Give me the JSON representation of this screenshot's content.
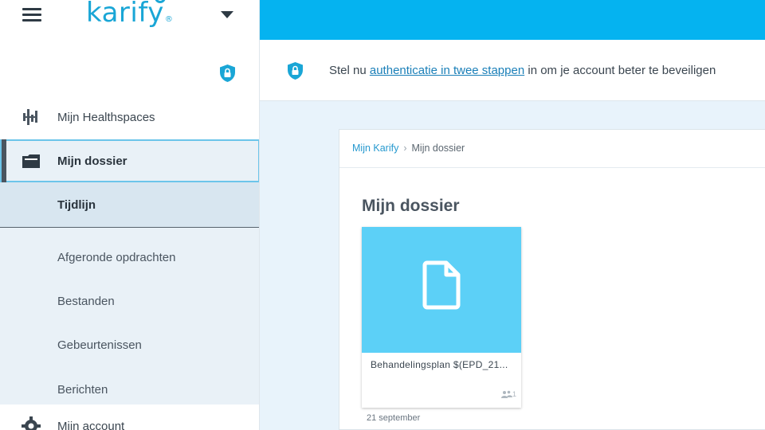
{
  "app": {
    "logo_text": "karify",
    "logo_mark": "®"
  },
  "sidebar": {
    "items": [
      {
        "label": "Mijn Healthspaces",
        "icon": "healthspaces-icon"
      },
      {
        "label": "Mijn dossier",
        "icon": "folder-icon",
        "active": true
      },
      {
        "label": "Mijn account",
        "icon": "gear-icon"
      }
    ],
    "subitems": [
      {
        "label": "Tijdlijn",
        "active": true
      },
      {
        "label": "Afgeronde opdrachten"
      },
      {
        "label": "Bestanden"
      },
      {
        "label": "Gebeurtenissen"
      },
      {
        "label": "Berichten"
      }
    ]
  },
  "notice": {
    "prefix": "Stel nu ",
    "link": "authenticatie in twee stappen",
    "suffix": " in om je account beter te beveiligen"
  },
  "breadcrumb": {
    "home": "Mijn Karify",
    "separator": "›",
    "current": "Mijn dossier"
  },
  "main": {
    "title": "Mijn dossier",
    "card": {
      "title": "Behandelingsplan $(EPD_21...",
      "share_count": "1",
      "date": "21 september"
    }
  },
  "colors": {
    "topbar": "#05b3f0",
    "brand": "#1aa6d6",
    "card_thumb": "#5cd0f7",
    "active_border": "#6cc5ea"
  }
}
